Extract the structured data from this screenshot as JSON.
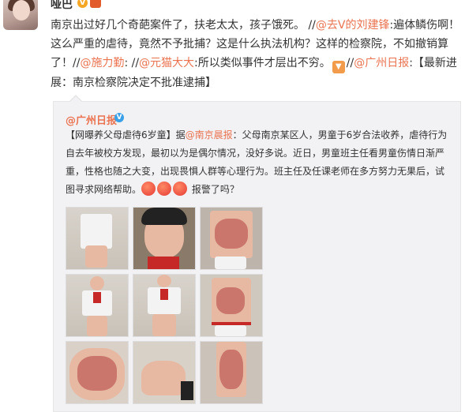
{
  "post": {
    "username": "哑巴",
    "text_main": "南京出过好几个奇葩案件了，扶老太太，孩子饿死。",
    "sep1": " //",
    "mention1": "@去V的刘建锋",
    "text1": ":遍体鳞伤啊！这么严重的虐待，竟然不予批捕？这是什么执法机构？这样的检察院，不如撤销算了！",
    "sep2": "//",
    "mention2": "@施力勤",
    "sep3": ": //",
    "mention3": "@元猫大大",
    "text2": ":所以类似事件才层出不穷。",
    "sep4": "//",
    "mention4": "@广州日报",
    "text3": ":【最新进展：南京检察院决定不批准逮捕】"
  },
  "repost": {
    "author": "@广州日报",
    "headline": "【网曝养父母虐待6岁童】",
    "lead": "据",
    "source": "@南京晨报",
    "body": "：父母南京某区人，男童于6岁合法收养，虐待行为自去年被校方发现，最初以为是偶尔情况，没好多说。近日，男童班主任看男童伤情日渐严重，性格也随之大变，出现畏惧人群等心理行为。班主任及任课老师在多方努力无果后，试图寻求网络帮助。",
    "tail": "报警了吗？"
  },
  "icons": {
    "verified": "verified-v-icon",
    "medal": "medal-icon",
    "thumb": "thumb-down-icon",
    "angry": "angry-face-icon"
  },
  "colors": {
    "link": "#eb7350",
    "repost_bg": "#f2f2f5",
    "verified_blue": "#3aa0e8"
  }
}
